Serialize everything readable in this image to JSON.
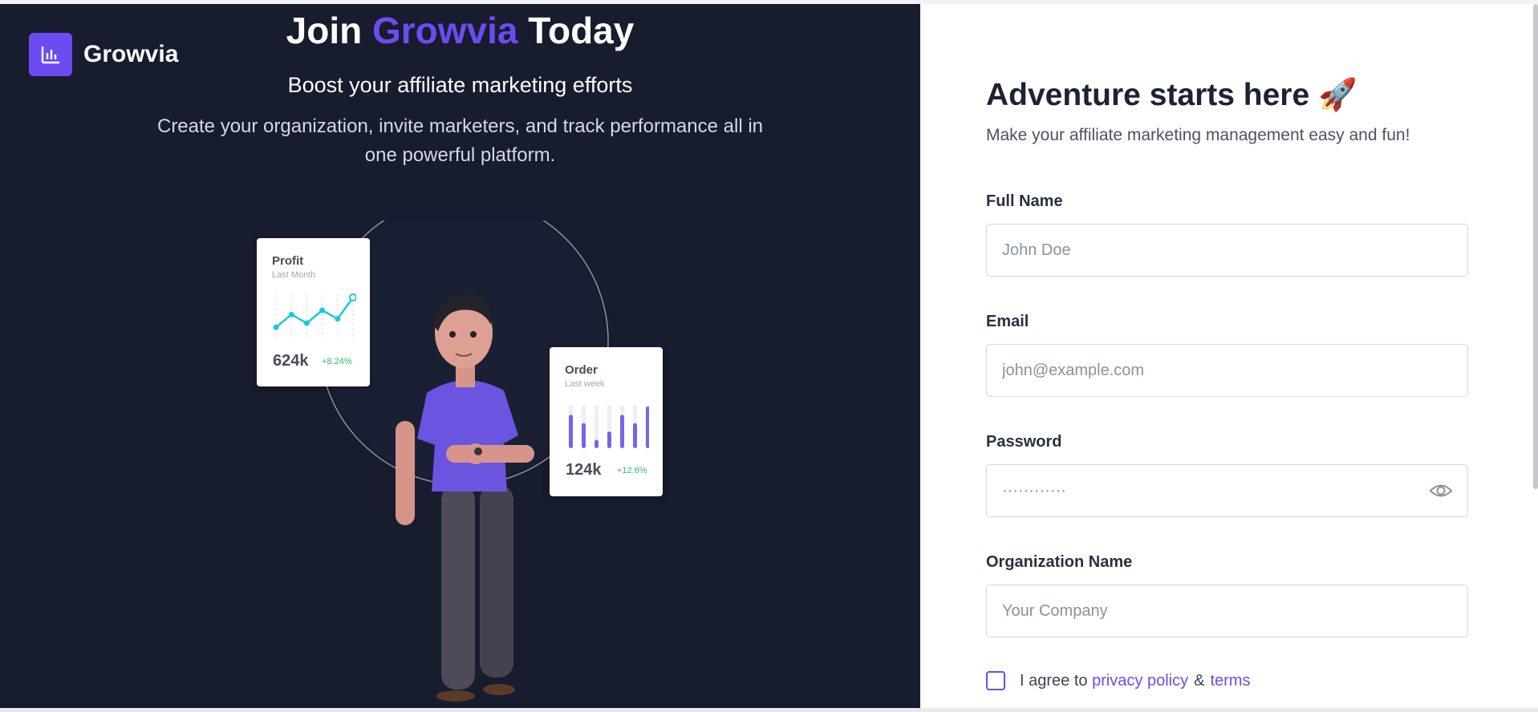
{
  "brand": {
    "name": "Growvia",
    "logo_icon": "bar-chart-icon",
    "accent_color": "#6c4cf1"
  },
  "hero": {
    "title_prefix": "Join",
    "title_brand": "Growvia",
    "title_suffix": "Today",
    "subtitle": "Boost your affiliate marketing efforts",
    "description": "Create your organization, invite marketers, and track performance all in one powerful platform."
  },
  "illustration": {
    "profit_card": {
      "title": "Profit",
      "period": "Last Month",
      "value": "624k",
      "delta": "+8.24%",
      "points": [
        2,
        5,
        3,
        6,
        4,
        9
      ]
    },
    "order_card": {
      "title": "Order",
      "period": "Last week",
      "value": "124k",
      "delta": "+12.6%",
      "bars": [
        8,
        6,
        2,
        4,
        8,
        6,
        10
      ]
    }
  },
  "form": {
    "title": "Adventure starts here 🚀",
    "subtitle": "Make your affiliate marketing management easy and fun!",
    "fields": {
      "full_name": {
        "label": "Full Name",
        "placeholder": "John Doe"
      },
      "email": {
        "label": "Email",
        "placeholder": "john@example.com"
      },
      "password": {
        "label": "Password",
        "placeholder": "············",
        "toggle_icon": "eye-icon"
      },
      "organization": {
        "label": "Organization Name",
        "placeholder": "Your Company"
      }
    },
    "agree": {
      "prefix": "I agree to",
      "privacy_link": "privacy policy",
      "amp": "&",
      "terms_link": "terms"
    }
  }
}
